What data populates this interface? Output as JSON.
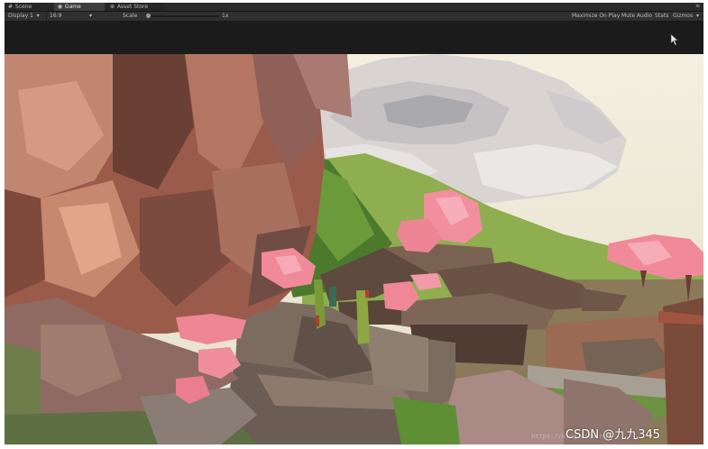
{
  "tabs": [
    {
      "label": "Scene",
      "icon": "grid-icon"
    },
    {
      "label": "Game",
      "icon": "gamepad-icon"
    },
    {
      "label": "Asset Store",
      "icon": "store-icon"
    }
  ],
  "toolbar": {
    "display": "Display 1",
    "aspect": "16:9",
    "scale_label": "Scale",
    "scale_value": "1x",
    "maximize": "Maximize On Play",
    "mute": "Mute Audio",
    "stats": "Stats",
    "gizmos": "Gizmos"
  },
  "watermark": {
    "name": "CSDN @九九345",
    "url": "https://blog.csdn.net/..."
  },
  "colors": {
    "panel": "#1b1b1b",
    "toolbar": "#2f2f2f",
    "active_tab": "#3d3d3d",
    "sky": "#efe9d8",
    "cliff": "#b3705a",
    "blossom": "#f08a9a",
    "roof": "#6a5346",
    "grass": "#6f9b3f"
  }
}
